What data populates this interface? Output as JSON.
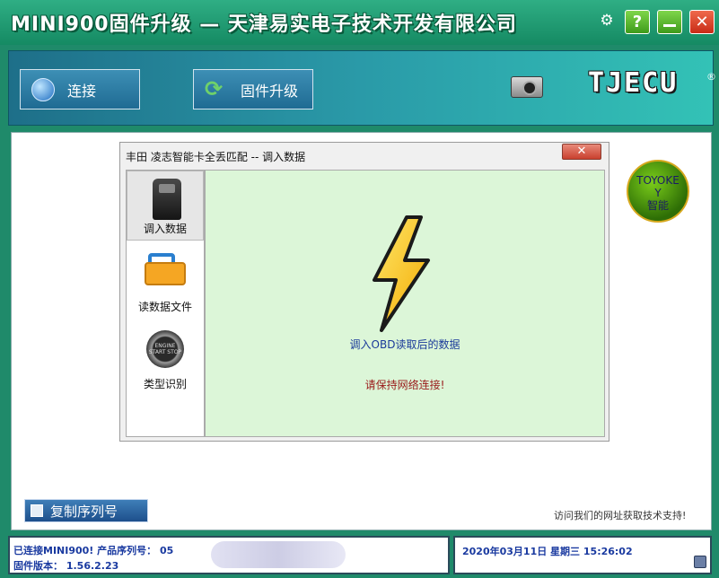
{
  "window": {
    "title": "MINI900固件升级 — 天津易实电子技术开发有限公司",
    "help_label": "?",
    "close_label": "✕"
  },
  "toolbar": {
    "connect_label": "连接",
    "upgrade_label": "固件升级",
    "brand": "TJECU",
    "brand_mark": "®"
  },
  "dialog": {
    "title": "丰田 凌志智能卡全丢匹配 -- 调入数据",
    "close_label": "✕",
    "sidebar": [
      {
        "label": "调入数据",
        "active": true
      },
      {
        "label": "读数据文件",
        "active": false
      },
      {
        "label": "类型识别",
        "active": false
      }
    ],
    "start_icon_text": "ENGINE START STOP",
    "content_message": "调入OBD读取后的数据",
    "content_warning": "请保持网络连接!"
  },
  "toyokey": {
    "line1": "TOYOKE",
    "line2": "Y",
    "line3": "智能"
  },
  "copy_serial_label": "复制序列号",
  "support_text": "访问我们的网址获取技术支持!",
  "status": {
    "line1": "已连接MINI900!    产品序列号：   05",
    "line2": "固件版本：  1.56.2.23",
    "datetime": "2020年03月11日   星期三    15:26:02"
  }
}
